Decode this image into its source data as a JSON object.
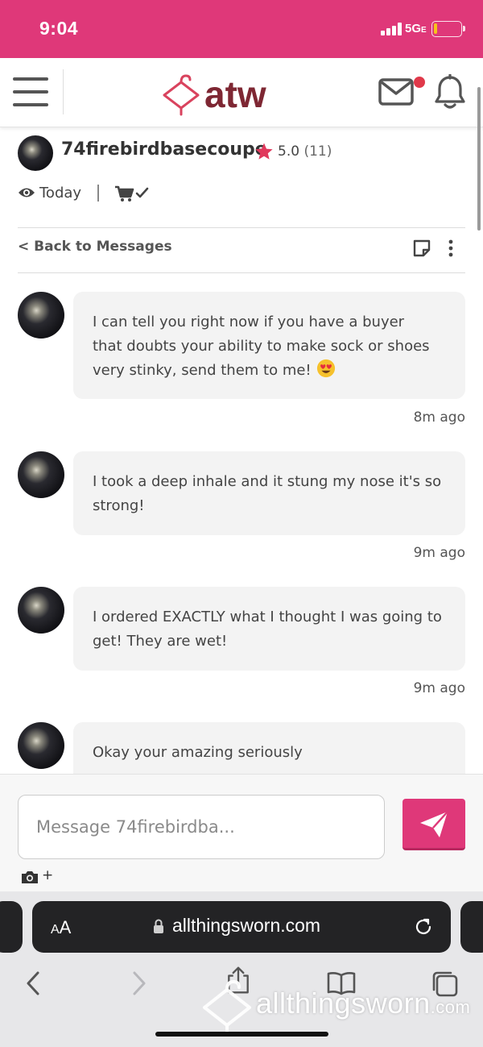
{
  "status_bar": {
    "time": "9:04",
    "network": "5G",
    "network_suffix": "E",
    "battery_level": 0.12,
    "battery_color": "#f7c21a",
    "background": "#df3879"
  },
  "header": {
    "logo_text": "atw",
    "logo_icon": "hanger-icon",
    "has_unread_mail": true,
    "notif_dot_color": "#e0394a"
  },
  "profile": {
    "username": "74firebirdbasecoupe",
    "rating": "5.0",
    "review_count": "(11)",
    "last_seen": "Today",
    "star_color": "#e0395c"
  },
  "nav": {
    "back_label": "< Back to Messages"
  },
  "messages": [
    {
      "text": "I can tell you right now if you have a buyer that doubts your ability to make sock or shoes very stinky, send them to me!",
      "emoji": "heart-eyes-emoji",
      "time": "8m ago"
    },
    {
      "text": "I took a deep inhale and it stung my nose it's so strong!",
      "time": "9m ago"
    },
    {
      "text": "I ordered EXACTLY what I thought I was going to get! They are wet!",
      "time": "9m ago"
    },
    {
      "text": "Okay your amazing seriously"
    }
  ],
  "composer": {
    "placeholder": "Message 74firebirdba...",
    "attach_plus": "+",
    "send_color": "#df3879"
  },
  "browser": {
    "aa_label_small": "A",
    "aa_label_large": "A",
    "url": "allthingsworn.com"
  },
  "watermark": {
    "text": "allthingsworn",
    "suffix": ".com"
  }
}
